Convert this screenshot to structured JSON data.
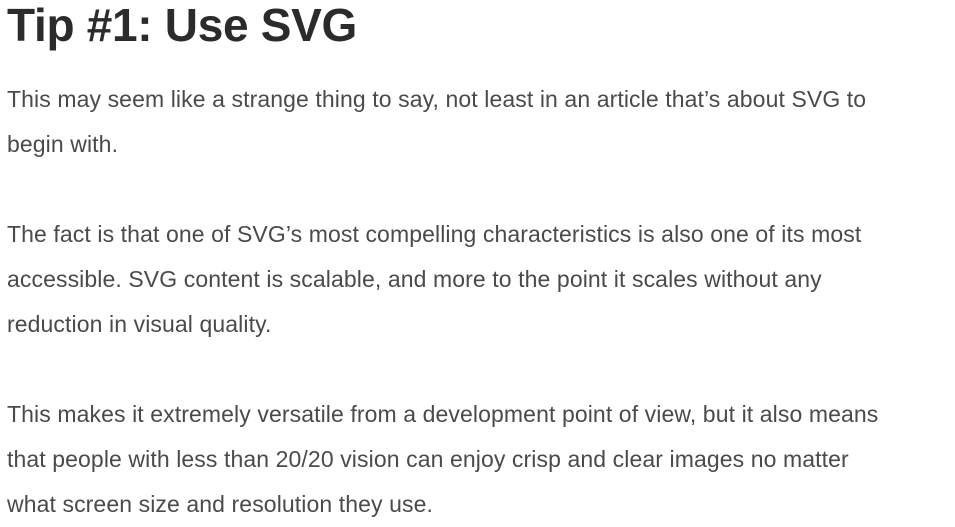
{
  "heading": "Tip #1: Use SVG",
  "paragraphs": [
    {
      "lines": [
        "This may seem like a strange thing to say, not least in an article that’s about SVG to",
        "begin with."
      ]
    },
    {
      "lines": [
        "The fact is that one of SVG’s most compelling characteristics is also one of its most",
        "accessible. SVG content is scalable, and more to the point it scales without any",
        "reduction in visual quality."
      ]
    },
    {
      "lines": [
        "This makes it extremely versatile from a development point of view, but it also means",
        "that people with less than 20/20 vision can enjoy crisp and clear images no matter",
        "what screen size and resolution they use."
      ]
    }
  ]
}
